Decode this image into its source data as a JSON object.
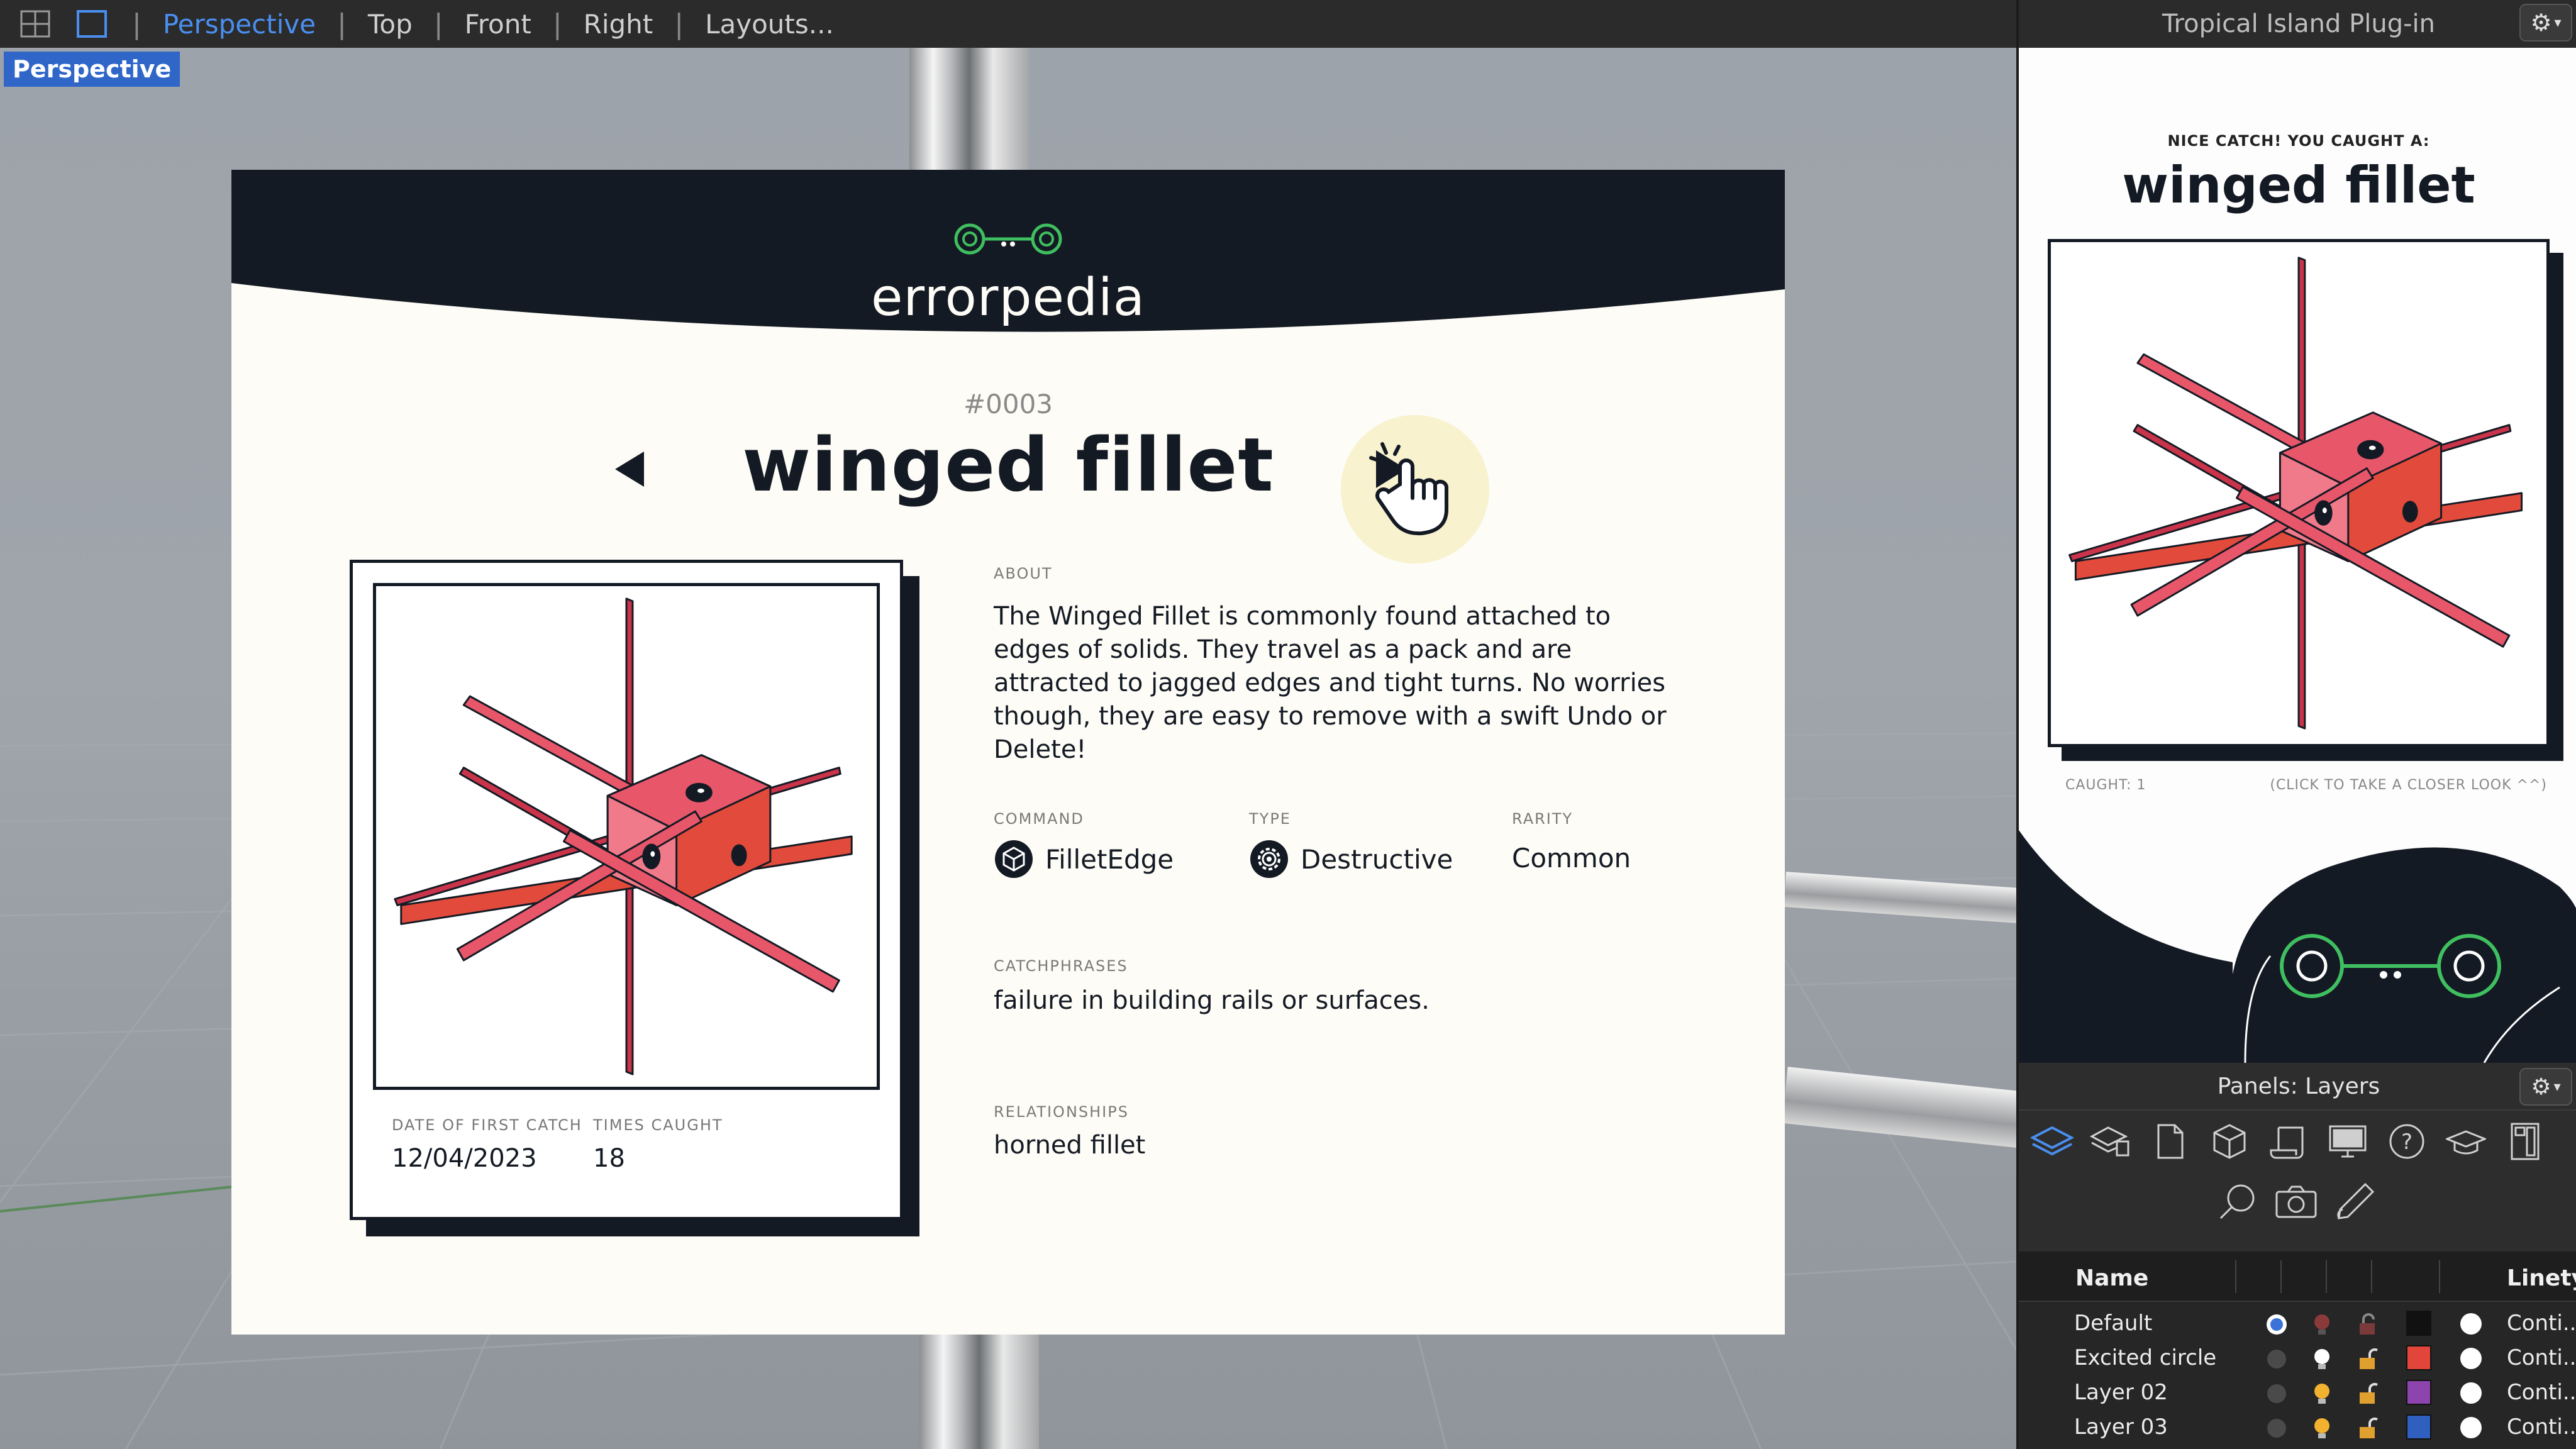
{
  "toolbar": {
    "tabs": [
      {
        "label": "Perspective",
        "active": true
      },
      {
        "label": "Top"
      },
      {
        "label": "Front"
      },
      {
        "label": "Right"
      },
      {
        "label": "Layouts..."
      }
    ],
    "icons": [
      "grid-layout-icon",
      "single-viewport-icon"
    ]
  },
  "viewport": {
    "label": "Perspective"
  },
  "card": {
    "brand": "errorpedia",
    "number": "#0003",
    "title": "winged fillet",
    "about_label": "ABOUT",
    "about": "The Winged Fillet is commonly found attached to edges of solids. They travel as a pack and are attracted to jagged edges and tight turns. No worries though, they are easy to remove with a swift Undo or Delete!",
    "command_label": "COMMAND",
    "command": "FilletEdge",
    "type_label": "TYPE",
    "type": "Destructive",
    "rarity_label": "RARITY",
    "rarity": "Common",
    "catchphrases_label": "CATCHPHRASES",
    "catchphrases": "failure in building rails or surfaces.",
    "relationships_label": "RELATIONSHIPS",
    "relationships": "horned fillet",
    "date_label": "DATE OF FIRST CATCH",
    "date": "12/04/2023",
    "times_label": "TIMES CAUGHT",
    "times": "18"
  },
  "plugin": {
    "title": "Tropical Island Plug-in",
    "catch_label": "NICE CATCH! YOU CAUGHT A:",
    "catch_title": "winged fillet",
    "caught_count": "CAUGHT: 1",
    "closer_look": "(CLICK TO TAKE A CLOSER LOOK ^^)"
  },
  "layers": {
    "title": "Panels: Layers",
    "col_name": "Name",
    "col_linetype": "Linetyp",
    "rows": [
      {
        "name": "Default",
        "color": "#111111",
        "linetype": "Conti..."
      },
      {
        "name": "Excited circle",
        "color": "#e2463a",
        "linetype": "Conti..."
      },
      {
        "name": "Layer 02",
        "color": "#8e44ad",
        "linetype": "Conti..."
      },
      {
        "name": "Layer 03",
        "color": "#2f5fbf",
        "linetype": "Conti..."
      }
    ]
  },
  "colors": {
    "accent": "#4a8ff0",
    "card_dark": "#141a24",
    "card_bg": "#fdfcf6",
    "creature_pink": "#e8566a",
    "creature_red": "#e24a3c",
    "mascot_green": "#3fbf5f"
  }
}
